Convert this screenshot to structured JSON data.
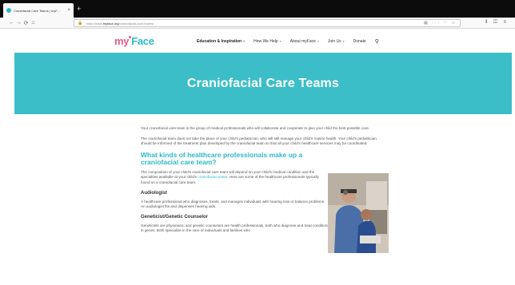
{
  "browser": {
    "tab_title": "Craniofacial Care Teams | myF…",
    "tab_close": "×",
    "new_tab": "+",
    "nav_back": "←",
    "nav_forward": "→",
    "nav_reload": "⟳",
    "nav_home": "⌂",
    "url_prefix": "https://www.",
    "url_host": "myface.org",
    "url_path": "/craniofacial-care-teams/",
    "url_icons": "▤ ··· ♡ ☆",
    "toolbar_icons": "⫴ ◫ ≡"
  },
  "site": {
    "logo_my": "my",
    "logo_face": "Face",
    "menu": [
      {
        "label": "Education & Inspiration",
        "caret": "▾"
      },
      {
        "label": "How We Help",
        "caret": "▾"
      },
      {
        "label": "About myFace",
        "caret": "▾"
      },
      {
        "label": "Join Us",
        "caret": "▾"
      },
      {
        "label": "Donate"
      }
    ],
    "search_glyph": "⚲"
  },
  "hero": {
    "title": "Craniofacial Care Teams"
  },
  "article": {
    "intro1": "Your craniofacial care team is the group of medical professionals who will collaborate and cooperate to give your child the best possible care.",
    "intro2": "The craniofacial team does not take the place of your child's pediatrician, who will still manage your child's routine health. Your child's pediatrician should be informed of the treatment plan developed by the craniofacial team so that all your child's healthcare services may be coordinated.",
    "heading": "What kinds of healthcare professionals make up a craniofacial care team?",
    "comp_text_a": "The composition of your child's craniofacial care team will depend on your child's medical condition and the specialties available at your child's ",
    "comp_link": "craniofacial center",
    "comp_text_b": ". Here are some of the healthcare professionals typically found on a craniofacial care team:",
    "audiologist_title": "Audiologist",
    "audiologist_text": "A healthcare professional who diagnoses, treats, and manages individuals with hearing loss or balance problems. An audiologist fits and dispenses hearing aids.",
    "geneticist_title": "Geneticist/Genetic Counselor",
    "geneticist_text": "Geneticists are physicians, and genetic counselors are health professionals, both who diagnose and treat conditions that may be caused by changes in genes. Both specialize in the care of individuals and families who"
  }
}
